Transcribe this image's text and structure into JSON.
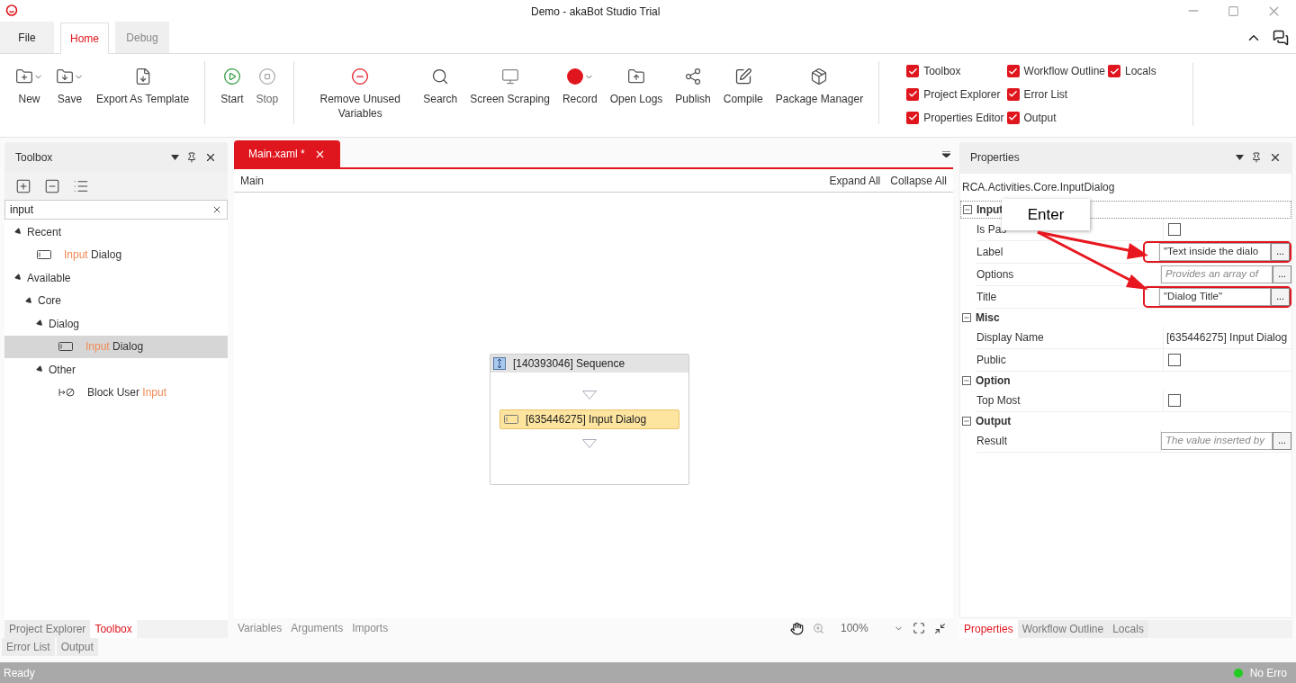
{
  "window": {
    "title": "Demo - akaBot Studio Trial"
  },
  "ribbon_tabs": [
    {
      "label": "File",
      "selected": false,
      "kind": "file"
    },
    {
      "label": "Home",
      "selected": true,
      "kind": "tab"
    },
    {
      "label": "Debug",
      "selected": false,
      "kind": "tab"
    }
  ],
  "ribbon_groups": [
    [
      {
        "label": "New",
        "has_menu": true,
        "disabled": false
      },
      {
        "label": "Save",
        "has_menu": true,
        "disabled": false
      },
      {
        "label": "Export As Template",
        "has_menu": false,
        "disabled": false
      }
    ],
    [
      {
        "label": "Start",
        "has_menu": false,
        "disabled": false
      },
      {
        "label": "Stop",
        "has_menu": false,
        "disabled": true
      }
    ],
    [
      {
        "label": "Remove Unused Variables",
        "has_menu": false,
        "disabled": false
      },
      {
        "label": "Search",
        "has_menu": false,
        "disabled": false
      },
      {
        "label": "Screen Scraping",
        "has_menu": false,
        "disabled": false
      },
      {
        "label": "Record",
        "has_menu": true,
        "disabled": false
      },
      {
        "label": "Open Logs",
        "has_menu": false,
        "disabled": false
      },
      {
        "label": "Publish",
        "has_menu": false,
        "disabled": false
      },
      {
        "label": "Compile",
        "has_menu": false,
        "disabled": false
      },
      {
        "label": "Package Manager",
        "has_menu": false,
        "disabled": false
      }
    ]
  ],
  "view_toggles": [
    {
      "label": "Toolbox",
      "checked": true
    },
    {
      "label": "Project Explorer",
      "checked": true
    },
    {
      "label": "Properties Editor",
      "checked": true
    },
    {
      "label": "Workflow Outline",
      "checked": true
    },
    {
      "label": "Error List",
      "checked": true
    },
    {
      "label": "Output",
      "checked": true
    },
    {
      "label": "Locals",
      "checked": true
    }
  ],
  "toolbox": {
    "title": "Toolbox",
    "search": {
      "value": "input"
    },
    "tree": [
      {
        "label": [
          {
            "text": "Recent",
            "match": false
          }
        ],
        "expanded": true,
        "selected": false,
        "children": [
          {
            "label": [
              {
                "text": "Input",
                "match": true
              },
              {
                "text": " Dialog",
                "match": false
              }
            ],
            "selected": false,
            "kind": "dialog"
          }
        ]
      },
      {
        "label": [
          {
            "text": "Available",
            "match": false
          }
        ],
        "expanded": true,
        "selected": false,
        "children": [
          {
            "label": [
              {
                "text": "Core",
                "match": false
              }
            ],
            "expanded": true,
            "selected": false,
            "children": [
              {
                "label": [
                  {
                    "text": "Dialog",
                    "match": false
                  }
                ],
                "expanded": true,
                "selected": false,
                "children": [
                  {
                    "label": [
                      {
                        "text": "Input",
                        "match": true
                      },
                      {
                        "text": " Dialog",
                        "match": false
                      }
                    ],
                    "selected": true,
                    "kind": "dialog"
                  }
                ]
              },
              {
                "label": [
                  {
                    "text": "Other",
                    "match": false
                  }
                ],
                "expanded": true,
                "selected": false,
                "children": [
                  {
                    "label": [
                      {
                        "text": "Block User ",
                        "match": false
                      },
                      {
                        "text": "Input",
                        "match": true
                      }
                    ],
                    "selected": false,
                    "kind": "block"
                  }
                ]
              }
            ]
          }
        ]
      }
    ],
    "bottom_tabs": [
      {
        "label": "Project Explorer",
        "selected": false
      },
      {
        "label": "Toolbox",
        "selected": true
      }
    ]
  },
  "editor": {
    "tabs": [
      {
        "label": "Main.xaml *",
        "selected": true
      }
    ],
    "breadcrumb": "Main",
    "actions": [
      "Expand All",
      "Collapse All"
    ],
    "sequence": {
      "title": "[140393046] Sequence",
      "activities": [
        {
          "title": "[635446275] Input Dialog",
          "selected": true
        }
      ]
    },
    "bottom_tabs": [
      {
        "label": "Variables",
        "selected": false
      },
      {
        "label": "Arguments",
        "selected": false
      },
      {
        "label": "Imports",
        "selected": false
      }
    ],
    "zoom": "100%"
  },
  "properties": {
    "title": "Properties",
    "type_name": "RCA.Activities.Core.InputDialog",
    "categories": [
      {
        "name": "Input",
        "expanded": true,
        "rows": [
          {
            "label": "Is Pas",
            "kind": "checkbox",
            "checked": false
          },
          {
            "label": "Label",
            "kind": "expression",
            "value": "\"Text inside the dialo",
            "button": "...",
            "annotated": true
          },
          {
            "label": "Options",
            "kind": "expression",
            "placeholder": "Provides an array of",
            "button": "...",
            "annotated": false
          },
          {
            "label": "Title",
            "kind": "expression",
            "value": "\"Dialog Title\"",
            "button": "...",
            "annotated": true
          }
        ]
      },
      {
        "name": "Misc",
        "expanded": true,
        "rows": [
          {
            "label": "Display Name",
            "kind": "text",
            "value": "[635446275] Input Dialog"
          },
          {
            "label": "Public",
            "kind": "checkbox",
            "checked": false
          }
        ]
      },
      {
        "name": "Option",
        "expanded": true,
        "rows": [
          {
            "label": "Top Most",
            "kind": "checkbox",
            "checked": false
          }
        ]
      },
      {
        "name": "Output",
        "expanded": true,
        "rows": [
          {
            "label": "Result",
            "kind": "expression",
            "placeholder": "The value inserted by",
            "button": "...",
            "annotated": false
          }
        ]
      }
    ],
    "callout": {
      "text": "Enter"
    },
    "bottom_tabs": [
      {
        "label": "Properties",
        "selected": true
      },
      {
        "label": "Workflow Outline",
        "selected": false
      },
      {
        "label": "Locals",
        "selected": false
      }
    ]
  },
  "output_tabs": [
    {
      "label": "Error List",
      "selected": false
    },
    {
      "label": "Output",
      "selected": false
    }
  ],
  "status_bar": {
    "text": "Ready",
    "status": "No Erro",
    "ok": true
  }
}
